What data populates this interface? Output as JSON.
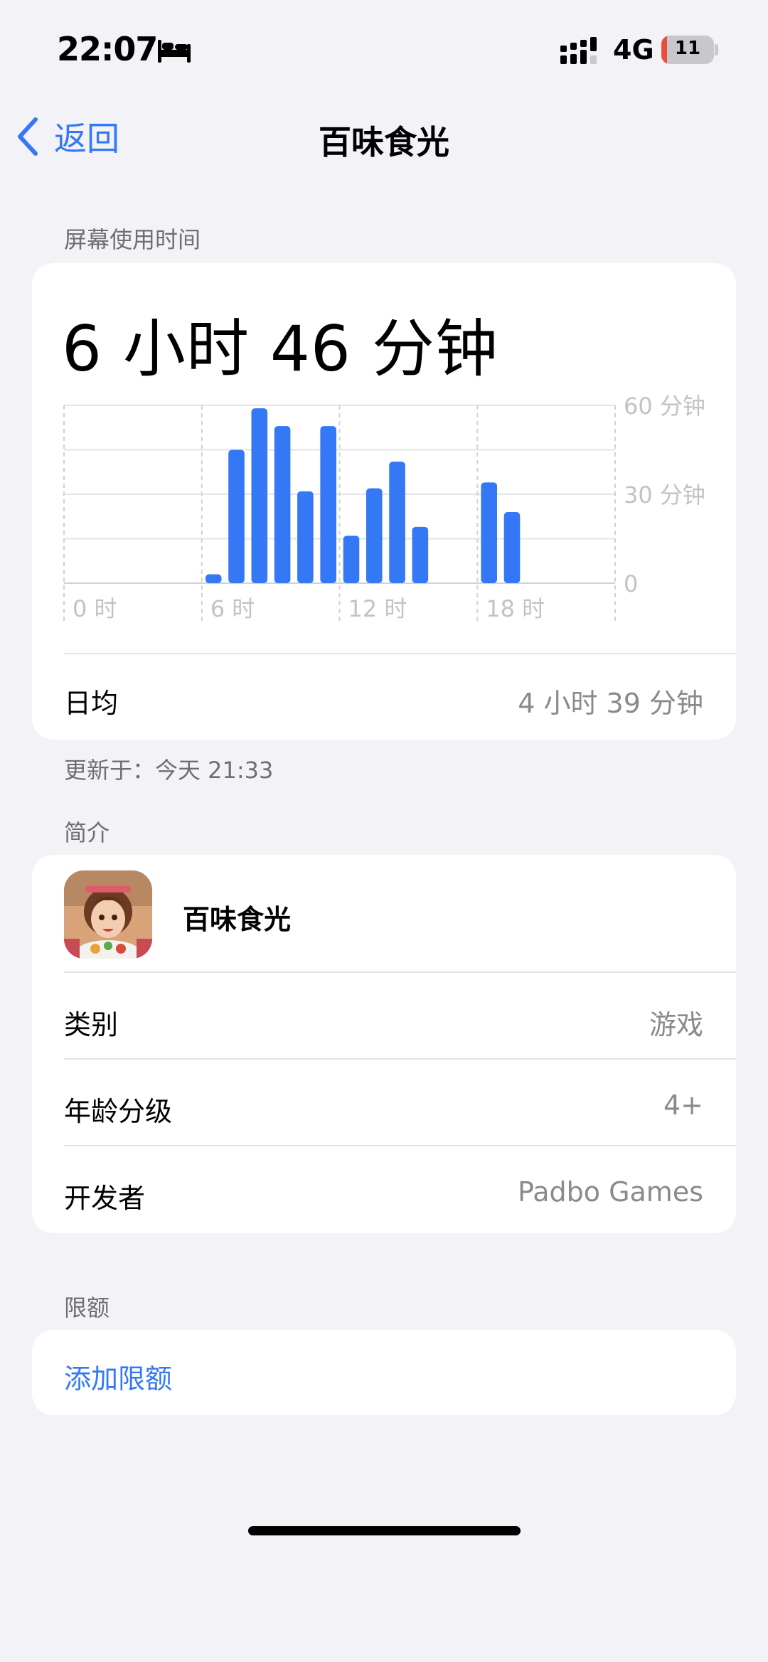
{
  "status_bar": {
    "time": "22:07",
    "network": "4G",
    "battery_level": "11",
    "battery_fraction": 0.11,
    "icons": [
      "bed-icon",
      "signal-icon",
      "battery-icon"
    ]
  },
  "nav": {
    "back_label": "返回",
    "title": "百味食光"
  },
  "screen_time": {
    "section_label": "屏幕使用时间",
    "total": "6 小时 46 分钟",
    "daily_avg_label": "日均",
    "daily_avg_value": "4 小时 39 分钟",
    "updated": "更新于：今天 21:33"
  },
  "chart_data": {
    "type": "bar",
    "x_unit": "hour",
    "x_ticks": [
      "0 时",
      "6 时",
      "12 时",
      "18 时"
    ],
    "y_ticks": [
      "60 分钟",
      "30 分钟",
      "0"
    ],
    "ylim": [
      0,
      60
    ],
    "bar_color": "#3478f6",
    "bars": [
      {
        "hour": 6,
        "minutes": 3
      },
      {
        "hour": 7,
        "minutes": 45
      },
      {
        "hour": 8,
        "minutes": 59
      },
      {
        "hour": 9,
        "minutes": 53
      },
      {
        "hour": 10,
        "minutes": 31
      },
      {
        "hour": 11,
        "minutes": 53
      },
      {
        "hour": 12,
        "minutes": 16
      },
      {
        "hour": 13,
        "minutes": 32
      },
      {
        "hour": 14,
        "minutes": 41
      },
      {
        "hour": 15,
        "minutes": 19
      },
      {
        "hour": 18,
        "minutes": 34
      },
      {
        "hour": 19,
        "minutes": 24
      }
    ]
  },
  "intro": {
    "section_label": "简介",
    "app_name": "百味食光",
    "rows": [
      {
        "label": "类别",
        "value": "游戏"
      },
      {
        "label": "年龄分级",
        "value": "4+"
      },
      {
        "label": "开发者",
        "value": "Padbo Games"
      }
    ]
  },
  "limits": {
    "section_label": "限额",
    "add_label": "添加限额"
  },
  "colors": {
    "accent": "#3478f6",
    "background": "#f2f2f7",
    "card": "#ffffff",
    "secondary_text": "#8a8a8e",
    "battery_low": "#eb4d3d"
  }
}
